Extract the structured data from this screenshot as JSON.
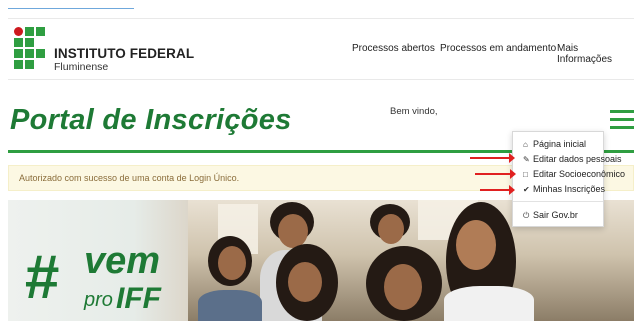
{
  "header": {
    "institution_name": "INSTITUTO FEDERAL",
    "institution_sub": "Fluminense",
    "nav": [
      {
        "label": "Processos abertos"
      },
      {
        "label": "Processos em andamento"
      },
      {
        "label": "Mais Informações"
      }
    ]
  },
  "page": {
    "title": "Portal de Inscrições",
    "welcome": "Bem vindo,"
  },
  "alert": {
    "message": "Autorizado com sucesso de uma conta de Login Único."
  },
  "menu": {
    "items": [
      {
        "label": "Página inicial",
        "icon": "home-icon"
      },
      {
        "label": "Editar dados pessoais",
        "icon": "pencil-icon"
      },
      {
        "label": "Editar Socioeconômico",
        "icon": "edit-icon"
      },
      {
        "label": "Minhas Inscrições",
        "icon": "check-icon"
      },
      {
        "label": "Sair Gov.br",
        "icon": "power-icon"
      }
    ]
  },
  "banner": {
    "hashtag": "#",
    "vem": "vem",
    "pro": "pro",
    "iff": "IFF"
  },
  "colors": {
    "brand_green": "#2f9e41",
    "title_green": "#1e7a35",
    "logo_red": "#cd191e",
    "alert_bg": "#fcf8e3",
    "alert_text": "#8a6d3b",
    "annotation_arrow": "#e02020"
  }
}
